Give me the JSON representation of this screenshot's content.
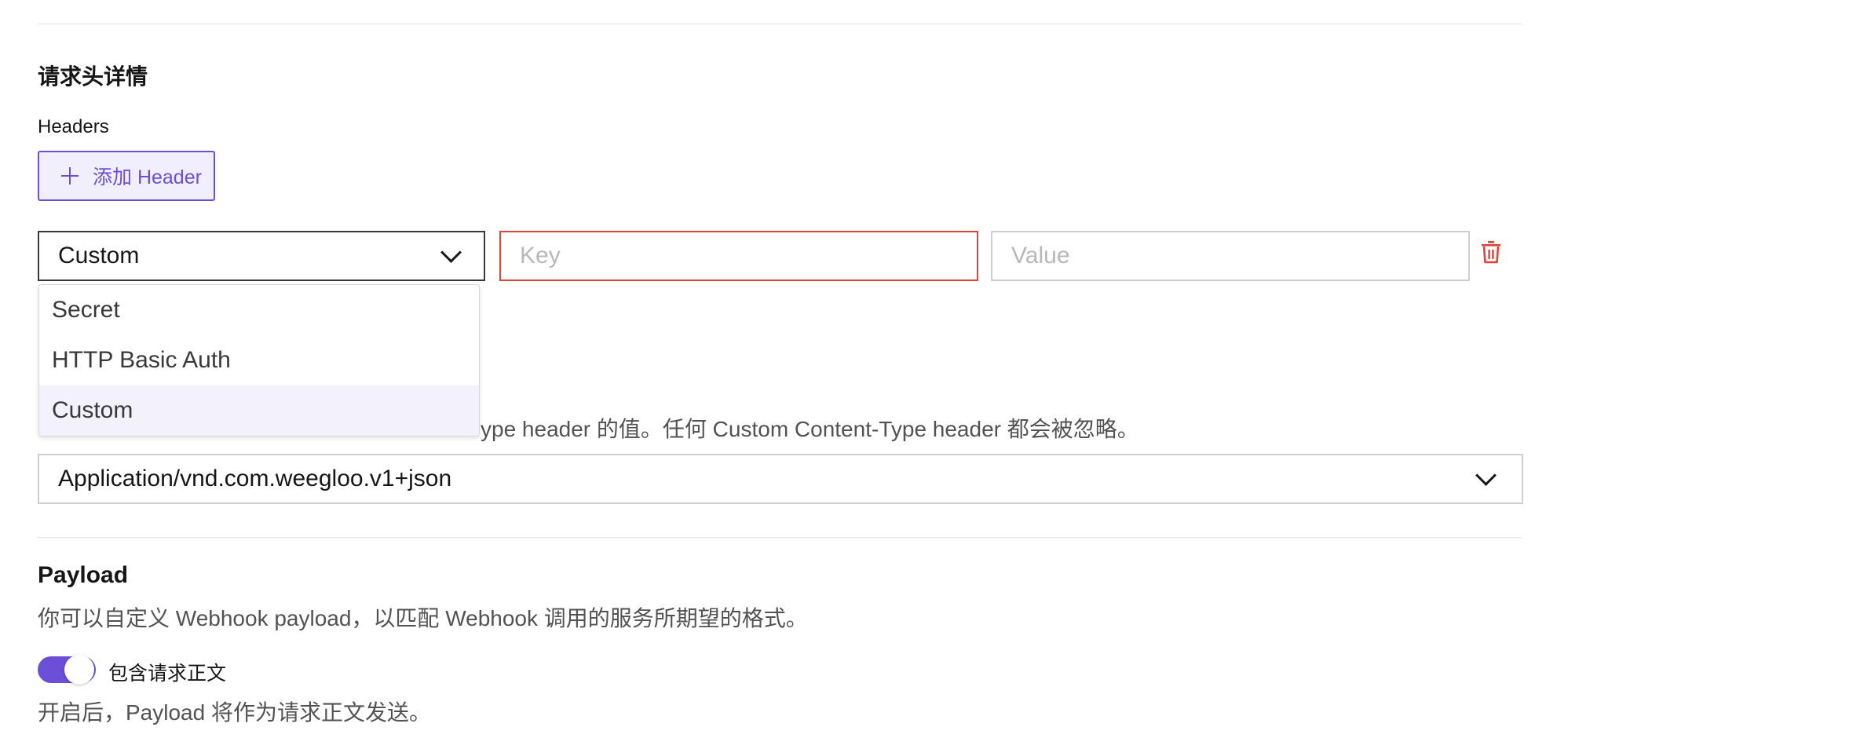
{
  "headers_section": {
    "title": "请求头详情",
    "headers_label": "Headers",
    "add_button_label": "添加 Header",
    "row": {
      "type_value": "Custom",
      "key_placeholder": "Key",
      "value_placeholder": "Value"
    },
    "type_options": [
      "Secret",
      "HTTP Basic Auth",
      "Custom"
    ],
    "selected_option": "Custom"
  },
  "content_type": {
    "help_visible": "ype header 的值。任何 Custom Content-Type header 都会被忽略。",
    "value": "Application/vnd.com.weegloo.v1+json"
  },
  "payload": {
    "title": "Payload",
    "description": "你可以自定义 Webhook payload，以匹配 Webhook 调用的服务所期望的格式。",
    "toggle_label": "包含请求正文",
    "toggle_on": true,
    "toggle_help": "开启后，Payload 将作为请求正文发送。"
  },
  "colors": {
    "accent": "#6b4fd8",
    "error": "#e0423a"
  },
  "icons": {
    "add": "plus-icon",
    "select": "chevron-down-icon",
    "delete": "trash-icon"
  }
}
